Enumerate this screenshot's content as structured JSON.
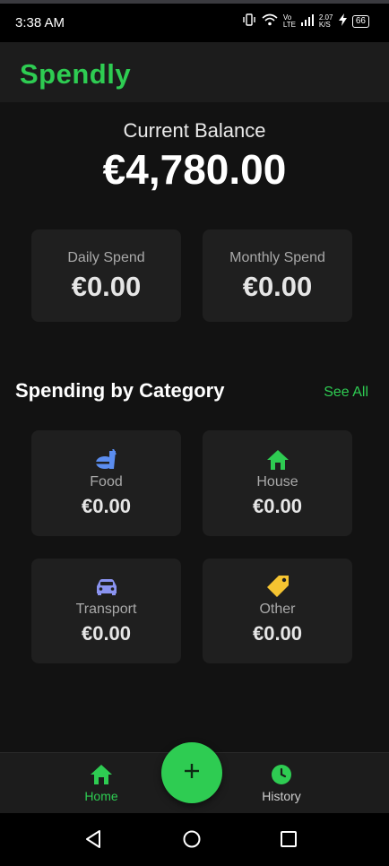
{
  "status_bar": {
    "time": "3:38 AM",
    "network_speed": "2.07 K/S",
    "battery": "66",
    "volte": "Vo LTE"
  },
  "app": {
    "title": "Spendly"
  },
  "balance": {
    "label": "Current Balance",
    "value": "€4,780.00"
  },
  "summary": [
    {
      "label": "Daily Spend",
      "value": "€0.00"
    },
    {
      "label": "Monthly Spend",
      "value": "€0.00"
    }
  ],
  "categories_section": {
    "title": "Spending by Category",
    "see_all": "See All",
    "items": [
      {
        "name": "Food",
        "value": "€0.00",
        "icon": "food-icon",
        "color": "#5b8def"
      },
      {
        "name": "House",
        "value": "€0.00",
        "icon": "house-icon",
        "color": "#2ecc52"
      },
      {
        "name": "Transport",
        "value": "€0.00",
        "icon": "car-icon",
        "color": "#8a93f0"
      },
      {
        "name": "Other",
        "value": "€0.00",
        "icon": "tag-icon",
        "color": "#f5c431"
      }
    ]
  },
  "bottom_nav": {
    "items": [
      {
        "label": "Home",
        "icon": "home-icon",
        "active": true
      },
      {
        "label": "History",
        "icon": "history-icon",
        "active": false
      }
    ],
    "fab_icon": "plus-icon"
  },
  "colors": {
    "accent": "#2ecc52",
    "background": "#121212",
    "card": "#1f1f1f"
  }
}
